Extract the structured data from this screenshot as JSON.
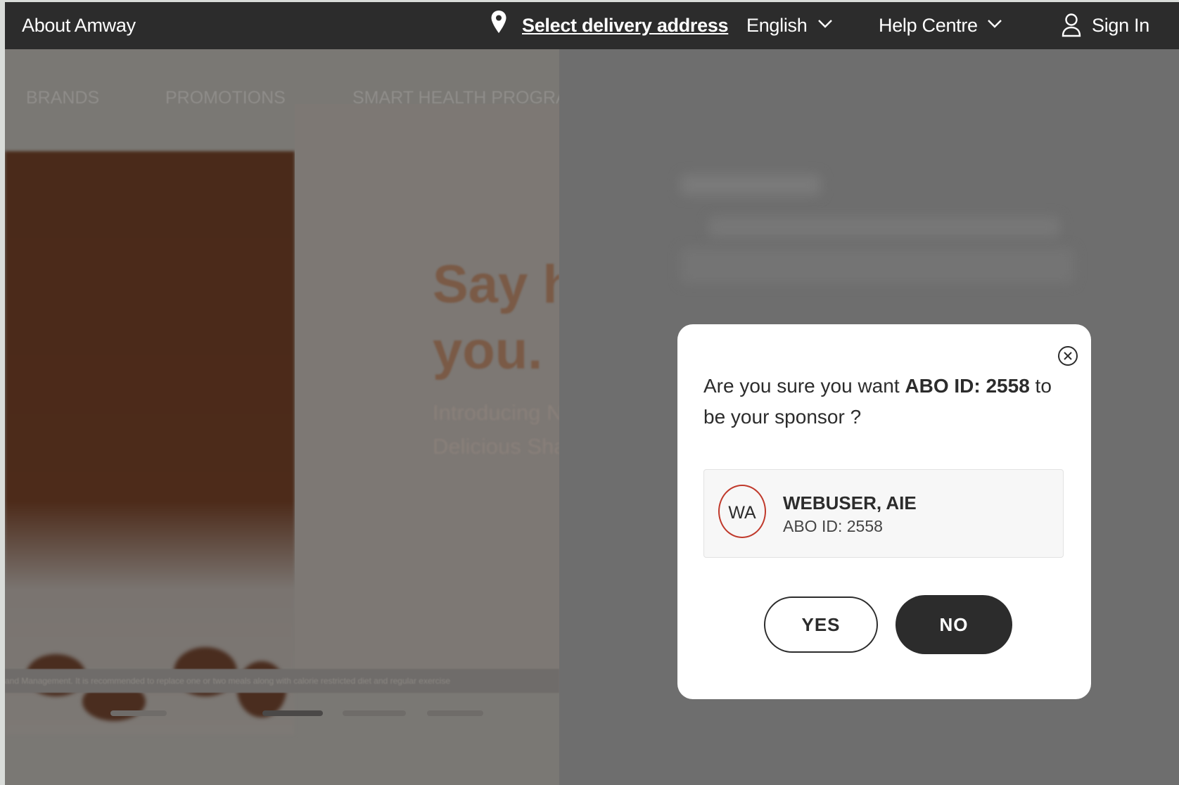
{
  "topbar": {
    "about_label": "About Amway",
    "delivery_label": "Select delivery address",
    "language_label": "English",
    "help_label": "Help Centre",
    "signin_label": "Sign In"
  },
  "background": {
    "nav": {
      "brands": "BRANDS",
      "promotions": "PROMOTIONS",
      "smart_health": "SMART HEALTH PROGRAM"
    },
    "hero": {
      "headline_1": "Say h",
      "headline_2": "you.",
      "sub_1": "Introducing N",
      "sub_2": "Delicious Sha"
    },
    "disclaimer": "and Management. It is recommended to replace one or two meals along with calorie restricted diet and regular exercise"
  },
  "modal": {
    "question_prefix": "Are you sure you want ",
    "question_bold": "ABO ID: 2558",
    "question_suffix": " to be your sponsor ?",
    "sponsor": {
      "initials": "WA",
      "name": "WEBUSER, AIE",
      "abo_id": "ABO ID: 2558"
    },
    "yes_label": "YES",
    "no_label": "NO"
  },
  "colors": {
    "topbar": "#2c2c2c",
    "overlay": "#7a7876",
    "avatar_ring": "#c0392b",
    "primary_button": "#2c2c2c"
  }
}
